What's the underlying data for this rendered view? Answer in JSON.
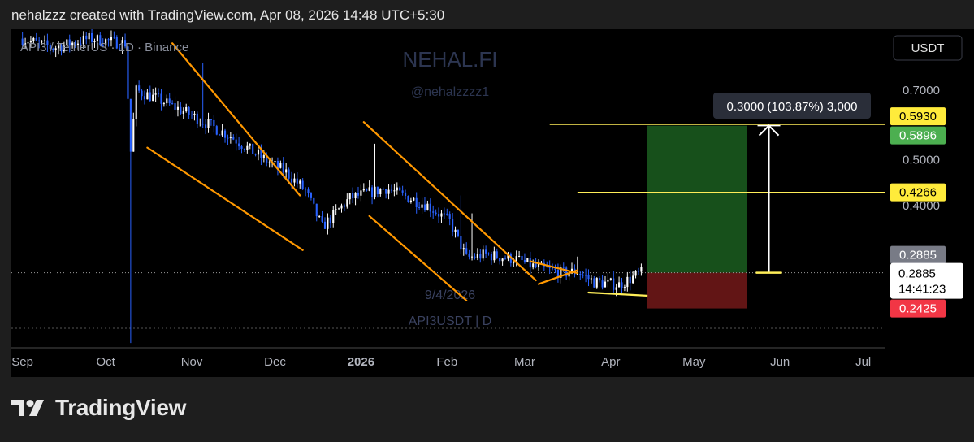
{
  "header": {
    "caption": "nehalzzz created with TradingView.com, Apr 08, 2026 14:48 UTC+5:30"
  },
  "symbol_line": "API3 / TetherUS · 1D · Binance",
  "watermark": {
    "brand": "NEHAL.FI",
    "handle": "@nehalzzzz1",
    "symbol": "API3USDT | D",
    "date": "9/4/2026"
  },
  "currency_button": "USDT",
  "measure_label": "0.3000 (103.87%) 3,000",
  "footer": {
    "brand": "TradingView"
  },
  "colors": {
    "candle_up": "#ffffff",
    "candle_down": "#2962ff",
    "trendline": "#ff9800",
    "level_line": "#ffee58",
    "profit_zone": "#1b5e20",
    "loss_zone": "#6d1717",
    "price_tag_yellow": "#ffeb3b",
    "price_tag_green": "#4caf50",
    "price_tag_red": "#f23645",
    "price_tag_grey": "#787b86",
    "background": "#000000"
  },
  "chart_data": {
    "type": "candlestick",
    "title": "API3 / TetherUS · 1D · Binance",
    "x_tick_labels": [
      "Sep",
      "Oct",
      "Nov",
      "Dec",
      "2026",
      "Feb",
      "Mar",
      "Apr",
      "May",
      "Jun",
      "Jul"
    ],
    "y_tick_labels": [
      0.7,
      0.5,
      0.4
    ],
    "y_tick_text": [
      "0.7000",
      "0.5000",
      "0.4000"
    ],
    "y_scale": "log",
    "y_range": [
      0.21,
      0.92
    ],
    "x_range": [
      "2025-08-28",
      "2026-07-09"
    ],
    "current_price": 0.2885,
    "countdown": "14:41:23",
    "price_tags": [
      {
        "name": "target",
        "value": 0.593,
        "text": "0.5930",
        "color": "yellow"
      },
      {
        "name": "take_profit",
        "value": 0.5896,
        "text": "0.5896",
        "color": "green"
      },
      {
        "name": "mid_level",
        "value": 0.4266,
        "text": "0.4266",
        "color": "yellow"
      },
      {
        "name": "entry",
        "value": 0.2885,
        "text": "0.2885",
        "color": "grey"
      },
      {
        "name": "stop_loss",
        "value": 0.2425,
        "text": "0.2425",
        "color": "red"
      }
    ],
    "horizontal_levels": [
      0.593,
      0.4266
    ],
    "position": {
      "entry": 0.2885,
      "target": 0.5896,
      "stop": 0.2425,
      "start": "2026-04-14",
      "end": "2026-05-20"
    },
    "measure": {
      "from": 0.2885,
      "to": 0.5896,
      "date": "2026-05-28",
      "label": "0.3000 (103.87%) 3,000"
    },
    "trendlines": [
      {
        "from": [
          "2025-10-25",
          0.88
        ],
        "to": [
          "2025-12-10",
          0.42
        ]
      },
      {
        "from": [
          "2025-10-16",
          0.53
        ],
        "to": [
          "2025-12-11",
          0.322
        ]
      },
      {
        "from": [
          "2026-01-02",
          0.6
        ],
        "to": [
          "2026-03-05",
          0.278
        ]
      },
      {
        "from": [
          "2026-01-04",
          0.38
        ],
        "to": [
          "2026-02-08",
          0.252
        ]
      },
      {
        "from": [
          "2026-03-03",
          0.305
        ],
        "to": [
          "2026-03-20",
          0.288
        ]
      },
      {
        "from": [
          "2026-03-06",
          0.273
        ],
        "to": [
          "2026-03-20",
          0.292
        ]
      },
      {
        "from": [
          "2026-03-24",
          0.262
        ],
        "to": [
          "2026-04-14",
          0.258
        ]
      }
    ],
    "close_anchors": [
      [
        "2025-09-01",
        0.9
      ],
      [
        "2025-09-12",
        0.86
      ],
      [
        "2025-09-25",
        0.9
      ],
      [
        "2025-10-08",
        0.88
      ],
      [
        "2025-10-10",
        0.52
      ],
      [
        "2025-10-12",
        0.7
      ],
      [
        "2025-10-20",
        0.67
      ],
      [
        "2025-11-01",
        0.62
      ],
      [
        "2025-11-15",
        0.56
      ],
      [
        "2025-11-25",
        0.51
      ],
      [
        "2025-12-05",
        0.47
      ],
      [
        "2025-12-12",
        0.43
      ],
      [
        "2025-12-18",
        0.36
      ],
      [
        "2025-12-28",
        0.415
      ],
      [
        "2026-01-10",
        0.435
      ],
      [
        "2026-01-14",
        0.425
      ],
      [
        "2026-01-25",
        0.4
      ],
      [
        "2026-02-02",
        0.37
      ],
      [
        "2026-02-08",
        0.31
      ],
      [
        "2026-02-15",
        0.315
      ],
      [
        "2026-02-26",
        0.308
      ],
      [
        "2026-03-05",
        0.296
      ],
      [
        "2026-03-15",
        0.288
      ],
      [
        "2026-03-20",
        0.29
      ],
      [
        "2026-03-26",
        0.276
      ],
      [
        "2026-04-04",
        0.272
      ],
      [
        "2026-04-12",
        0.2885
      ]
    ],
    "spikes": [
      [
        "2025-10-10",
        0.205
      ],
      [
        "2025-11-05",
        0.8
      ],
      [
        "2026-01-06",
        0.54
      ],
      [
        "2026-02-06",
        0.42
      ],
      [
        "2026-02-10",
        0.385
      ],
      [
        "2026-03-20",
        0.312
      ]
    ]
  }
}
